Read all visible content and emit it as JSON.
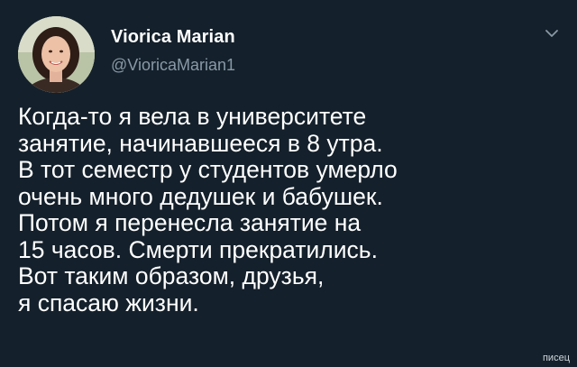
{
  "author": {
    "display_name": "Viorica Marian",
    "handle": "@VioricaMarian1"
  },
  "tweet": {
    "lines": [
      "Когда-то я вела в университете",
      "занятие, начинавшееся в 8 утра.",
      "В тот семестр у студентов умерло",
      "очень много дедушек и бабушек.",
      "Потом я перенесла занятие на",
      "15 часов. Смерти прекратились.",
      "Вот таким образом, друзья,",
      "я спасаю жизни."
    ]
  },
  "menu": {
    "icon": "chevron-down-icon"
  },
  "watermark": "писец",
  "colors": {
    "background": "#14202b",
    "text": "#ffffff",
    "secondary_text": "#8899a6"
  }
}
